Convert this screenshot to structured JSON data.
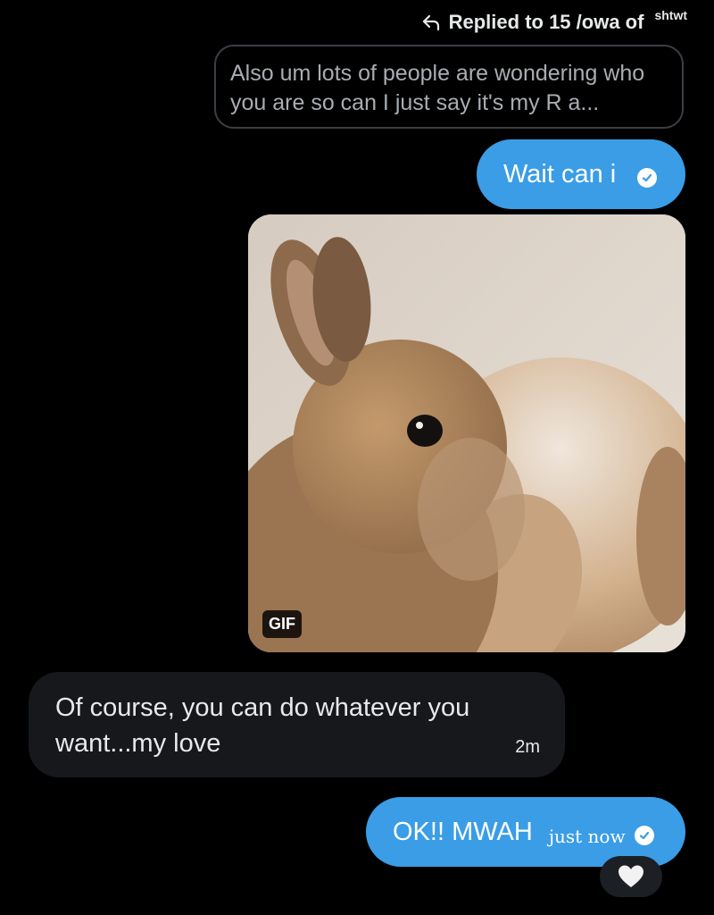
{
  "reply_header": {
    "label": "Replied to 15 /owa of",
    "tag": "shtwt"
  },
  "quoted_message": {
    "text": "Also um lots of people are wondering who you are so can I just say it's my R a..."
  },
  "messages": [
    {
      "direction": "outgoing",
      "text": "Wait can i",
      "status": "read"
    },
    {
      "direction": "outgoing",
      "type": "gif",
      "badge": "GIF"
    },
    {
      "direction": "incoming",
      "text": "Of course, you can do whatever you want...my love",
      "time": "2m"
    },
    {
      "direction": "outgoing",
      "text": "OK!! MWAH",
      "time": "just now",
      "status": "read",
      "reaction": "heart"
    }
  ],
  "colors": {
    "background": "#000000",
    "outgoing_bubble": "#3a9de6",
    "incoming_bubble": "#16181c",
    "quoted_border": "#3b3f44"
  }
}
